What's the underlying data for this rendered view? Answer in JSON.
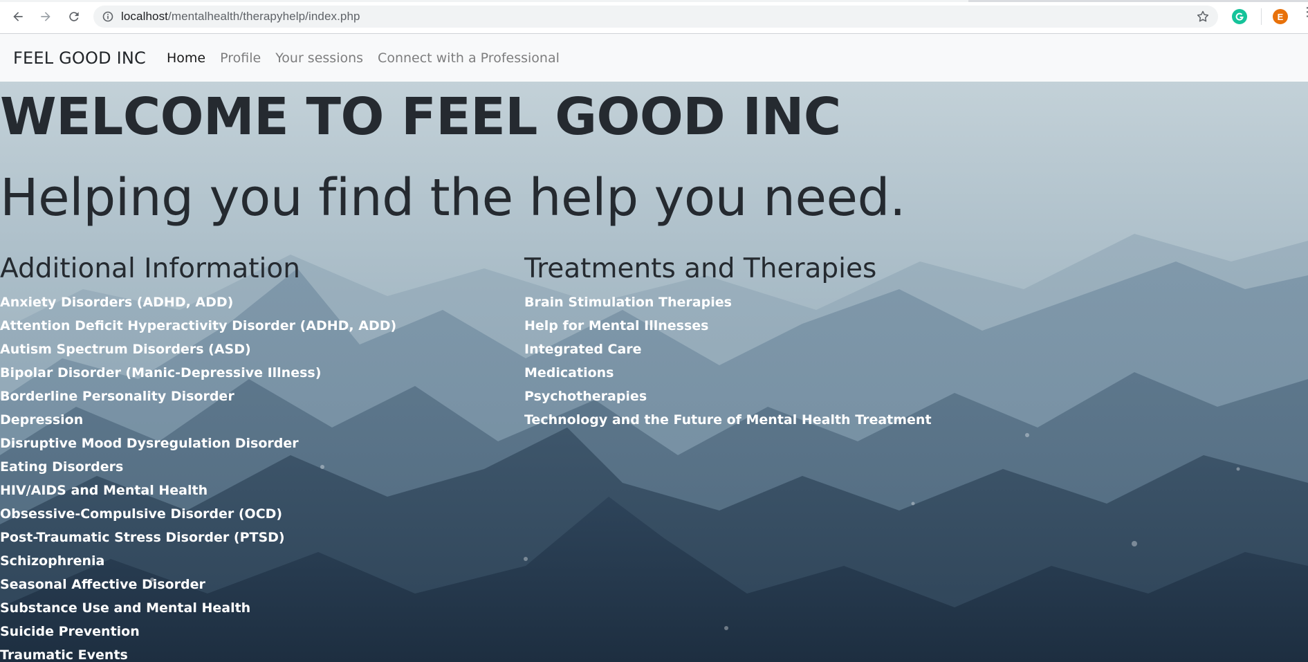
{
  "browser": {
    "url_host": "localhost",
    "url_path": "/mentalhealth/therapyhelp/index.php",
    "avatar_letter": "E"
  },
  "nav": {
    "brand": "FEEL GOOD INC",
    "links": [
      "Home",
      "Profile",
      "Your sessions",
      "Connect with a Professional"
    ]
  },
  "hero": {
    "title": "WELCOME TO FEEL GOOD INC",
    "subtitle": "Helping you find the help you need."
  },
  "additional": {
    "heading": "Additional Information",
    "items": [
      "Anxiety Disorders (ADHD, ADD)",
      "Attention Deficit Hyperactivity Disorder (ADHD, ADD)",
      "Autism Spectrum Disorders (ASD)",
      "Bipolar Disorder (Manic-Depressive Illness)",
      "Borderline Personality Disorder",
      "Depression",
      "Disruptive Mood Dysregulation Disorder",
      "Eating Disorders",
      "HIV/AIDS and Mental Health",
      "Obsessive-Compulsive Disorder (OCD)",
      "Post-Traumatic Stress Disorder (PTSD)",
      "Schizophrenia",
      "Seasonal Affective Disorder",
      "Substance Use and Mental Health",
      "Suicide Prevention",
      "Traumatic Events"
    ]
  },
  "treatments": {
    "heading": "Treatments and Therapies",
    "items": [
      "Brain Stimulation Therapies",
      "Help for Mental Illnesses",
      "Integrated Care",
      "Medications",
      "Psychotherapies",
      "Technology and the Future of Mental Health Treatment"
    ]
  },
  "icons": {
    "back": "back-arrow-icon",
    "forward": "forward-arrow-icon",
    "reload": "reload-icon",
    "info": "info-icon",
    "star": "star-icon",
    "grammarly": "grammarly-icon"
  },
  "colors": {
    "navbar_bg": "#f8f9fa",
    "heading_text": "#252a30",
    "link_text": "#ffffff",
    "grammarly": "#15c39a",
    "avatar": "#e8710a"
  }
}
